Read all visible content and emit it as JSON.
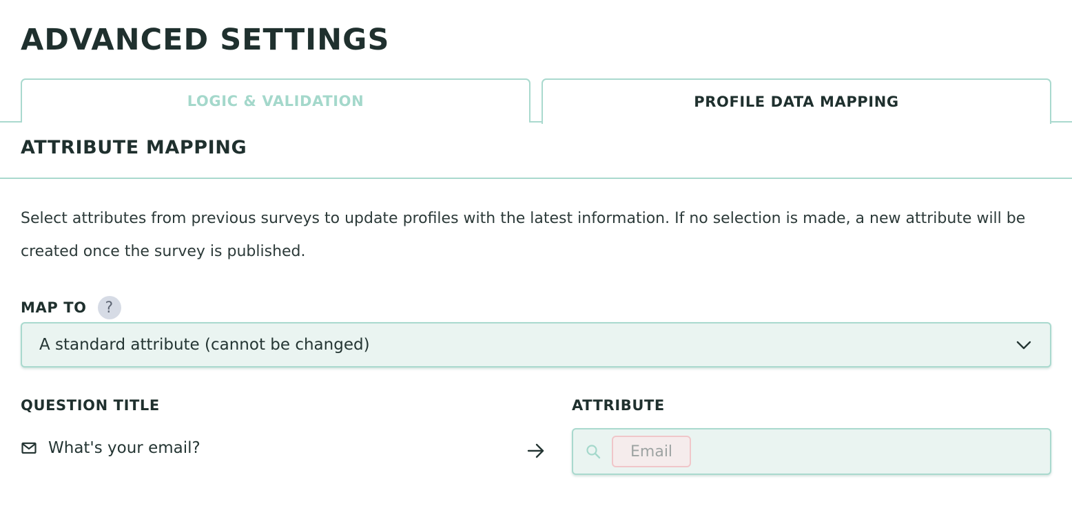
{
  "page": {
    "title": "ADVANCED SETTINGS"
  },
  "tabs": [
    {
      "label": "LOGIC & VALIDATION",
      "active": false
    },
    {
      "label": "PROFILE DATA MAPPING",
      "active": true
    }
  ],
  "section": {
    "title": "ATTRIBUTE MAPPING",
    "description": "Select attributes from previous surveys to update profiles with the latest information. If no selection is made, a new attribute will be created once the survey is published."
  },
  "map_to": {
    "label": "MAP TO",
    "help_icon": "question-mark",
    "help_glyph": "?",
    "selected_value": "A standard attribute (cannot be changed)"
  },
  "mapping": {
    "question_column_label": "QUESTION TITLE",
    "attribute_column_label": "ATTRIBUTE",
    "rows": [
      {
        "question_icon": "mail-icon",
        "question_text": "What's your email?",
        "arrow_icon": "arrow-right-icon",
        "attribute_value": "Email"
      }
    ]
  },
  "colors": {
    "accent_border": "#a9d9ce",
    "inactive_tab_text": "#a4d8cb",
    "field_background": "#eaf4f1",
    "chip_border": "#f0c6c9",
    "chip_background": "#f5ecec",
    "heading_text": "#1f302e"
  }
}
